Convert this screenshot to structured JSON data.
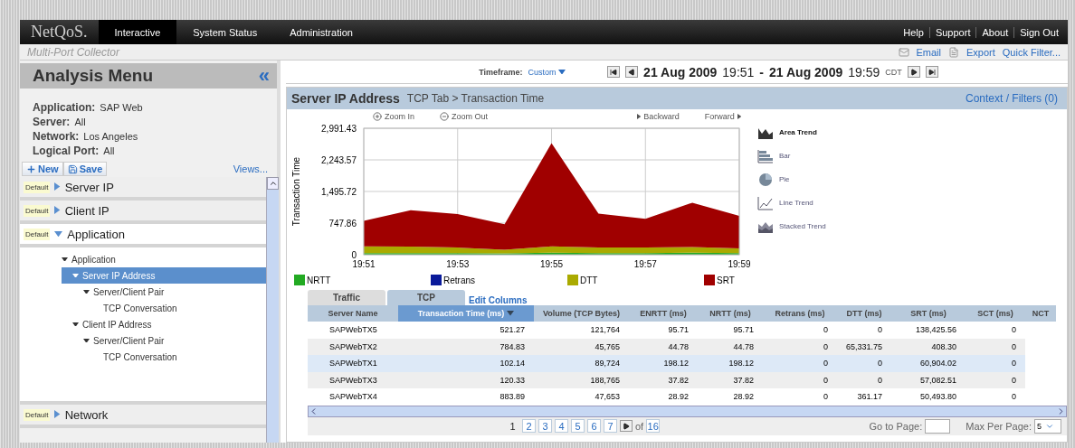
{
  "top_bar": {
    "logo": "NetQoS.",
    "tabs": [
      {
        "label": "Interactive",
        "selected": true
      },
      {
        "label": "System Status",
        "selected": false
      },
      {
        "label": "Administration",
        "selected": false
      }
    ],
    "links": [
      "Help",
      "Support",
      "About",
      "Sign Out"
    ]
  },
  "sub_header": {
    "title": "Multi-Port Collector",
    "actions": [
      {
        "kind": "email",
        "label": "Email"
      },
      {
        "kind": "export",
        "label": "Export"
      },
      {
        "kind": "plain",
        "label": "Quick Filter..."
      }
    ]
  },
  "sidebar": {
    "title": "Analysis Menu",
    "collapse": "«",
    "info": [
      {
        "label": "Application:",
        "value": "SAP Web"
      },
      {
        "label": "Server:",
        "value": "All"
      },
      {
        "label": "Network:",
        "value": "Los Angeles"
      },
      {
        "label": "Logical Port:",
        "value": "All"
      }
    ],
    "new_button": "New",
    "save_button": "Save",
    "views_link": "Views...",
    "sections": [
      {
        "tag": "Default",
        "title": "Server IP",
        "expanded": false
      },
      {
        "tag": "Default",
        "title": "Client IP",
        "expanded": false
      },
      {
        "tag": "Default",
        "title": "Application",
        "expanded": true,
        "tree": [
          {
            "label": "Application",
            "selected": false,
            "children": [
              {
                "label": "Server IP Address",
                "selected": true,
                "children": [
                  {
                    "label": "Server/Client Pair",
                    "selected": false,
                    "children": [
                      {
                        "label": "TCP Conversation",
                        "selected": false
                      }
                    ]
                  }
                ]
              },
              {
                "label": "Client IP Address",
                "selected": false,
                "children": [
                  {
                    "label": "Server/Client Pair",
                    "selected": false,
                    "children": [
                      {
                        "label": "TCP Conversation",
                        "selected": false
                      }
                    ]
                  }
                ]
              }
            ]
          }
        ]
      },
      {
        "tag": "Default",
        "title": "Network",
        "expanded": false
      }
    ]
  },
  "timeframe": {
    "label": "Timeframe:",
    "value": "Custom",
    "start_date": "21 Aug 2009",
    "start_time": "19:51",
    "separator": "-",
    "end_date": "21 Aug 2009",
    "end_time": "19:59",
    "zone": "CDT"
  },
  "panel": {
    "title": "Server IP Address",
    "breadcrumb": "TCP Tab > Transaction Time",
    "context_link": "Context / Filters (0)",
    "chart_controls": [
      "Zoom In",
      "Zoom Out",
      "Backward",
      "Forward"
    ],
    "chart_types": [
      {
        "kind": "area",
        "label": "Area Trend",
        "selected": true
      },
      {
        "kind": "bar",
        "label": "Bar",
        "selected": false
      },
      {
        "kind": "pie",
        "label": "Pie",
        "selected": false
      },
      {
        "kind": "line",
        "label": "Line Trend",
        "selected": false
      },
      {
        "kind": "stacked",
        "label": "Stacked Trend",
        "selected": false
      }
    ],
    "chart_data": {
      "type": "area",
      "stacked": true,
      "grid": true,
      "ylabel": "Transaction Time",
      "categories": [
        "19:51",
        null,
        "19:53",
        null,
        "19:55",
        null,
        "19:57",
        null,
        "19:59"
      ],
      "ylim": [
        0,
        2991.43
      ],
      "yticks": [
        {
          "value": 0,
          "label": "0"
        },
        {
          "value": 747.86,
          "label": "747.86"
        },
        {
          "value": 1495.72,
          "label": "1,495.72"
        },
        {
          "value": 2243.57,
          "label": "2,243.57"
        },
        {
          "value": 2991.43,
          "label": "2,991.43"
        }
      ],
      "series": [
        {
          "name": "NRTT",
          "color": "#22aa22",
          "values": [
            40,
            40,
            40,
            30,
            50,
            40,
            40,
            50,
            40
          ]
        },
        {
          "name": "Retrans",
          "color": "#0a1a9a",
          "values": [
            null,
            null,
            null,
            null,
            null,
            null,
            null,
            null,
            null
          ]
        },
        {
          "name": "DTT",
          "color": "#aaaa00",
          "values": [
            160,
            150,
            130,
            90,
            150,
            130,
            130,
            130,
            110
          ]
        },
        {
          "name": "SRT",
          "color": "#a00000",
          "values": [
            600,
            860,
            790,
            600,
            2440,
            800,
            680,
            1050,
            770
          ]
        }
      ]
    },
    "tabs": [
      {
        "label": "Traffic",
        "selected": false
      },
      {
        "label": "TCP",
        "selected": true
      }
    ],
    "edit_columns": "Edit Columns",
    "table": {
      "columns": [
        {
          "label": "Server Name",
          "sorted": false
        },
        {
          "label": "Transaction Time (ms)",
          "sorted": true
        },
        {
          "label": "Volume (TCP Bytes)",
          "sorted": false
        },
        {
          "label": "ENRTT (ms)",
          "sorted": false
        },
        {
          "label": "NRTT (ms)",
          "sorted": false
        },
        {
          "label": "Retrans (ms)",
          "sorted": false
        },
        {
          "label": "DTT (ms)",
          "sorted": false
        },
        {
          "label": "SRT (ms)",
          "sorted": false
        },
        {
          "label": "SCT (ms)",
          "sorted": false
        },
        {
          "label": "NCT",
          "sorted": false
        }
      ],
      "rows": [
        {
          "selected": false,
          "cells": [
            "SAPWebTX5",
            "521.27",
            "121,764",
            "95.71",
            "95.71",
            "0",
            "0",
            "138,425.56",
            "0"
          ]
        },
        {
          "selected": false,
          "cells": [
            "SAPWebTX2",
            "784.83",
            "45,765",
            "44.78",
            "44.78",
            "0",
            "65,331.75",
            "408.30",
            "0"
          ]
        },
        {
          "selected": true,
          "cells": [
            "SAPWebTX1",
            "102.14",
            "89,724",
            "198.12",
            "198.12",
            "0",
            "0",
            "60,904.02",
            "0"
          ]
        },
        {
          "selected": false,
          "cells": [
            "SAPWebTX3",
            "120.33",
            "188,765",
            "37.82",
            "37.82",
            "0",
            "0",
            "57,082.51",
            "0"
          ]
        },
        {
          "selected": false,
          "cells": [
            "SAPWebTX4",
            "883.89",
            "47,653",
            "28.92",
            "28.92",
            "0",
            "361.17",
            "50,493.80",
            "0"
          ]
        }
      ]
    },
    "pager": {
      "pages": [
        {
          "label": "1",
          "selected": true
        },
        {
          "label": "2",
          "selected": false
        },
        {
          "label": "3",
          "selected": false
        },
        {
          "label": "4",
          "selected": false
        },
        {
          "label": "5",
          "selected": false
        },
        {
          "label": "6",
          "selected": false
        },
        {
          "label": "7",
          "selected": false
        }
      ],
      "of": "of",
      "total": "16",
      "goto_label": "Go to Page:",
      "max_label": "Max Per Page:",
      "max_value": "5"
    }
  }
}
